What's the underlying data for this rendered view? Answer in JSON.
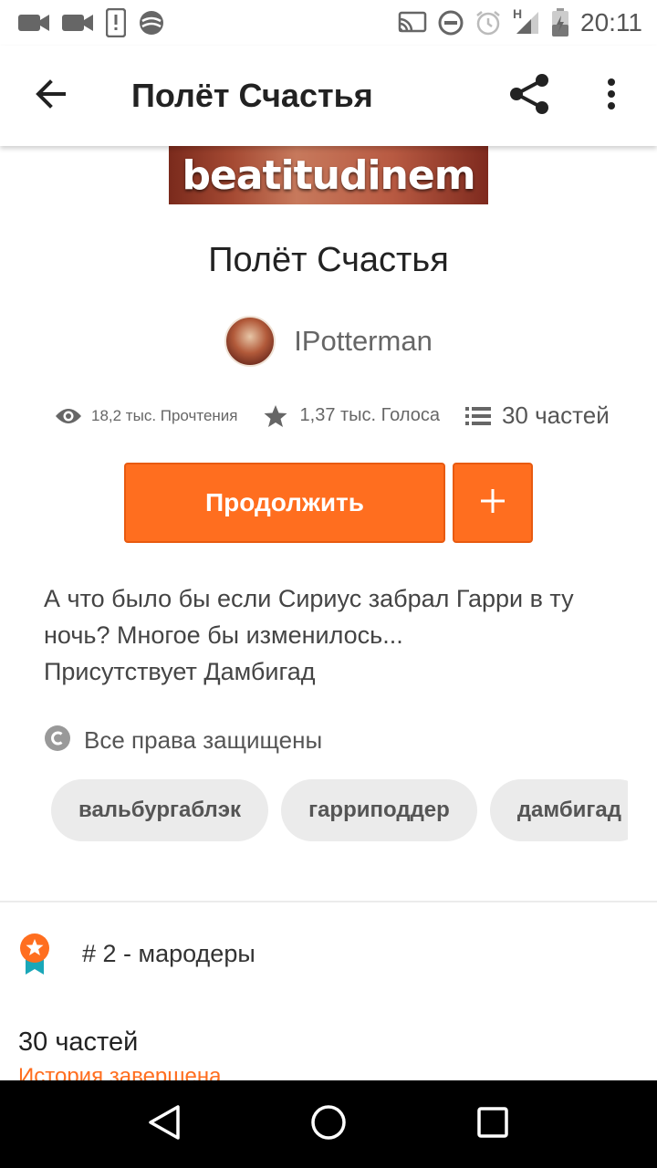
{
  "status_bar": {
    "time": "20:11",
    "network_label": "H"
  },
  "app_bar": {
    "title": "Полёт Счастья"
  },
  "cover": {
    "text": "beatitudinem"
  },
  "story": {
    "title": "Полёт Счастья",
    "author": "IPotterman",
    "stats": {
      "reads": "18,2 тыс. Прочтения",
      "votes": "1,37 тыс. Голоса",
      "parts": "30 частей"
    },
    "continue_label": "Продолжить",
    "add_label": "+",
    "description_lines": [
      "А что было бы если Сириус забрал Гарри в ту",
      "ночь? Многое бы изменилось...",
      "Присутствует Дамбигад"
    ],
    "rights": "Все права защищены",
    "tags": [
      "вальбургаблэк",
      "гарриподдер",
      "дамбигад"
    ],
    "rank": "# 2 - мародеры",
    "parts_count": "30 частей",
    "completion_status": "История завершена"
  },
  "colors": {
    "accent": "#ff6e1f",
    "tag_bg": "#ebebeb",
    "nav_bg": "#000000"
  },
  "icons": {
    "back": "arrow-left-icon",
    "share": "share-icon",
    "more": "more-vertical-icon",
    "reads": "eye-icon",
    "votes": "star-icon",
    "parts": "list-icon",
    "rights": "copyright-icon",
    "rank": "rank-badge-icon"
  }
}
